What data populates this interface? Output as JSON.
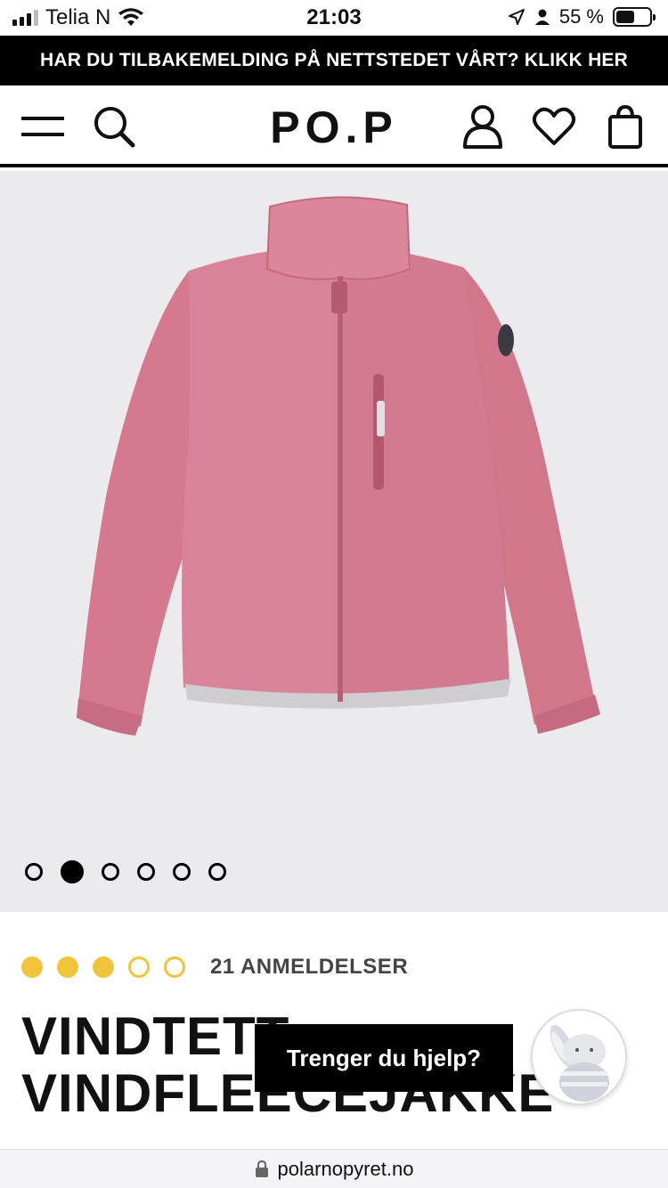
{
  "status_bar": {
    "carrier": "Telia N",
    "time": "21:03",
    "battery": "55 %",
    "battery_level": 0.55
  },
  "banner": {
    "text": "HAR DU TILBAKEMELDING PÅ NETTSTEDET VÅRT? KLIKK HER"
  },
  "header": {
    "logo": "PO.P",
    "icons": [
      "menu-icon",
      "search-icon",
      "account-icon",
      "heart-icon",
      "bag-icon"
    ]
  },
  "gallery": {
    "image": "pink fleece jacket",
    "slide_count": 6,
    "active_slide": 2
  },
  "product": {
    "rating": 3,
    "rating_max": 5,
    "reviews_label": "21 ANMELDELSER",
    "title_line1": "VINDTETT",
    "title_line2": "VINDFLEECEJAKKE"
  },
  "help": {
    "label": "Trenger du hjelp?"
  },
  "url_bar": {
    "domain": "polarnopyret.no"
  },
  "colors": {
    "banner_bg": "#000000",
    "jacket": "#d67a8e",
    "rating": "#f2c43c",
    "gallery_bg": "#ebebed"
  }
}
